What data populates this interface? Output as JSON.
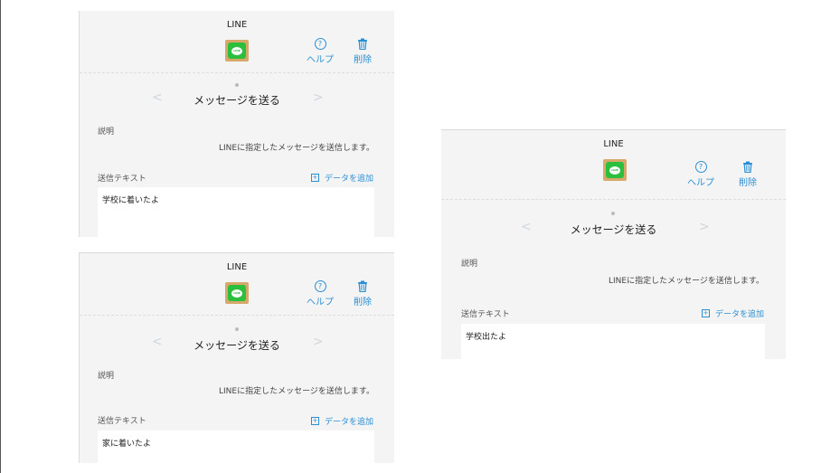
{
  "panels": [
    {
      "app_title": "LINE",
      "help_label": "ヘルプ",
      "delete_label": "削除",
      "action_title": "メッセージを送る",
      "description_label": "説明",
      "description_text": "LINEに指定したメッセージを送信します。",
      "send_text_label": "送信テキスト",
      "add_data_label": "データを追加",
      "message_value": "学校に着いたよ"
    },
    {
      "app_title": "LINE",
      "help_label": "ヘルプ",
      "delete_label": "削除",
      "action_title": "メッセージを送る",
      "description_label": "説明",
      "description_text": "LINEに指定したメッセージを送信します。",
      "send_text_label": "送信テキスト",
      "add_data_label": "データを追加",
      "message_value": "家に着いたよ"
    },
    {
      "app_title": "LINE",
      "help_label": "ヘルプ",
      "delete_label": "削除",
      "action_title": "メッセージを送る",
      "description_label": "説明",
      "description_text": "LINEに指定したメッセージを送信します。",
      "send_text_label": "送信テキスト",
      "add_data_label": "データを追加",
      "message_value": "学校出たよ"
    }
  ],
  "icons": {
    "app": "line-app-icon",
    "help": "help-circle-icon",
    "delete": "trash-icon",
    "prev": "chevron-left-icon",
    "next": "chevron-right-icon",
    "add": "plus-square-icon"
  },
  "colors": {
    "accent": "#2b8fd3",
    "panel_bg": "#f4f4f4",
    "line_green": "#2bbf3d"
  }
}
